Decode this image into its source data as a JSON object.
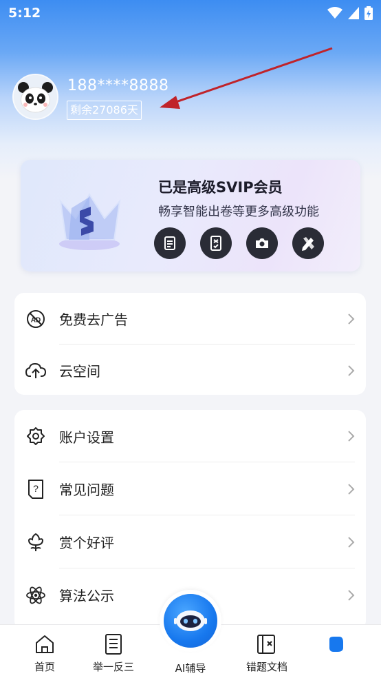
{
  "status_bar": {
    "time": "5:12",
    "icons": [
      "wifi-icon",
      "signal-icon",
      "battery-charging-icon"
    ]
  },
  "profile": {
    "avatar": "panda-avatar",
    "phone": "188****8888",
    "remaining": "剩余27086天"
  },
  "vip": {
    "title": "已是高级SVIP会员",
    "subtitle": "畅享智能出卷等更多高级功能",
    "feature_icons": [
      "scroll-document-icon",
      "error-book-icon",
      "camera-icon",
      "pencil-ruler-icon"
    ]
  },
  "menu_group_1": [
    {
      "icon": "no-ad-icon",
      "label": "免费去广告"
    },
    {
      "icon": "cloud-upload-icon",
      "label": "云空间"
    }
  ],
  "menu_group_2": [
    {
      "icon": "gear-icon",
      "label": "账户设置"
    },
    {
      "icon": "question-document-icon",
      "label": "常见问题"
    },
    {
      "icon": "flower-icon",
      "label": "赏个好评"
    },
    {
      "icon": "atom-icon",
      "label": "算法公示"
    }
  ],
  "bottom_nav": [
    {
      "icon": "home-icon",
      "label": "首页"
    },
    {
      "icon": "list-document-icon",
      "label": "举一反三"
    },
    {
      "icon": "robot-icon",
      "label": "AI辅导"
    },
    {
      "icon": "error-doc-icon",
      "label": "错题文档"
    },
    {
      "icon": "profile-blob-icon",
      "label": ""
    }
  ],
  "colors": {
    "accent": "#1778ee",
    "header_top": "#3d8df2",
    "arrow": "#c0232a"
  }
}
